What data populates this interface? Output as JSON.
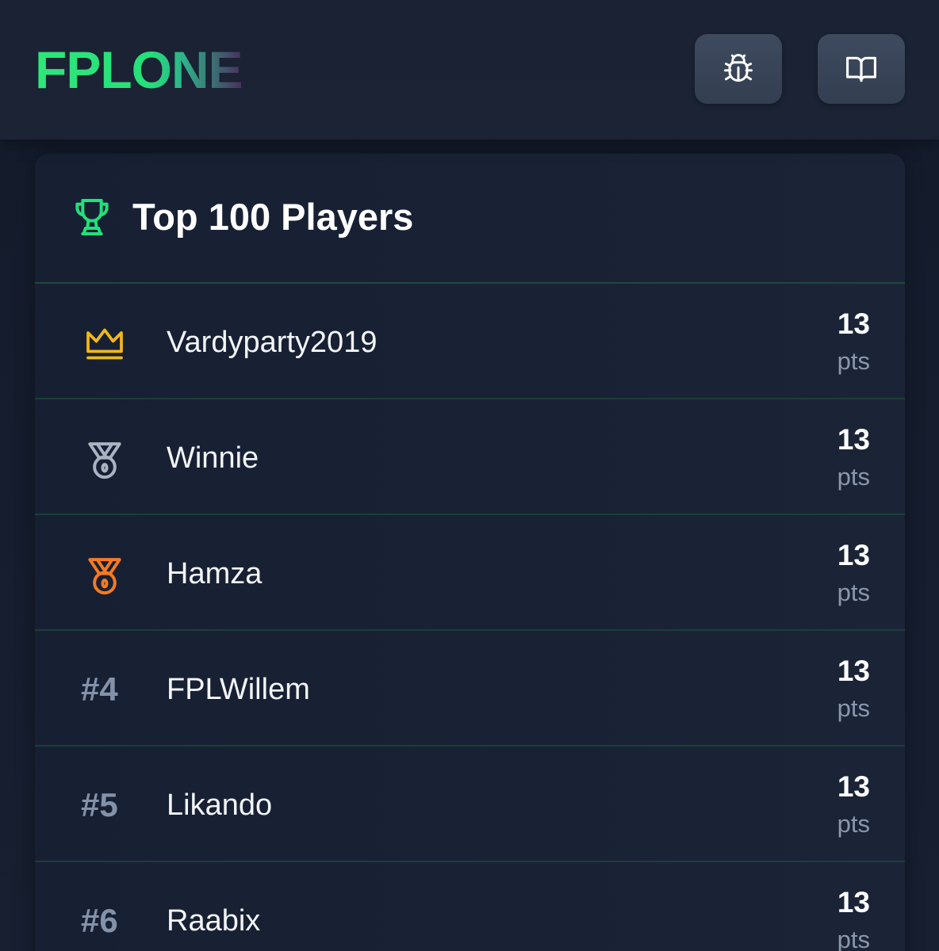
{
  "header": {
    "logo": "FPLONE",
    "bug_icon": "bug-icon",
    "docs_icon": "open-book-icon"
  },
  "leaderboard": {
    "title": "Top 100 Players",
    "title_icon": "trophy-icon",
    "accent_color": "#22e07a",
    "rows": [
      {
        "rank": "#1",
        "rank_icon": "crown-icon",
        "rank_color": "#f2b81a",
        "name": "Vardyparty2019",
        "points": "13",
        "unit": "pts"
      },
      {
        "rank": "#2",
        "rank_icon": "silver-medal-icon",
        "rank_color": "#aab3c0",
        "name": "Winnie",
        "points": "13",
        "unit": "pts"
      },
      {
        "rank": "#3",
        "rank_icon": "bronze-medal-icon",
        "rank_color": "#f47a22",
        "name": "Hamza",
        "points": "13",
        "unit": "pts"
      },
      {
        "rank": "#4",
        "name": "FPLWillem",
        "points": "13",
        "unit": "pts"
      },
      {
        "rank": "#5",
        "name": "Likando",
        "points": "13",
        "unit": "pts"
      },
      {
        "rank": "#6",
        "name": "Raabix",
        "points": "13",
        "unit": "pts"
      }
    ]
  }
}
